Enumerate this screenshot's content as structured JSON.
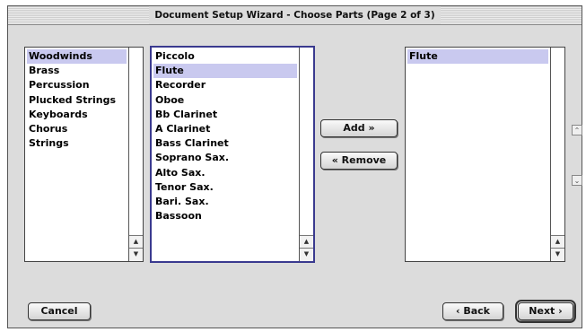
{
  "window": {
    "title": "Document Setup Wizard - Choose Parts (Page 2 of 3)"
  },
  "categories": {
    "items": [
      "Woodwinds",
      "Brass",
      "Percussion",
      "Plucked Strings",
      "Keyboards",
      "Chorus",
      "Strings"
    ],
    "selected": "Woodwinds"
  },
  "instruments": {
    "items": [
      "Piccolo",
      "Flute",
      "Recorder",
      "Oboe",
      "Bb Clarinet",
      "A Clarinet",
      "Bass Clarinet",
      "Soprano Sax.",
      "Alto Sax.",
      "Tenor Sax.",
      "Bari. Sax.",
      "Bassoon"
    ],
    "selected": "Flute"
  },
  "chosen": {
    "items": [
      "Flute"
    ],
    "selected": "Flute"
  },
  "buttons": {
    "add": "Add »",
    "remove": "« Remove",
    "cancel": "Cancel",
    "back": "‹ Back",
    "next": "Next ›"
  },
  "icons": {
    "scroll_up": "triangle-up",
    "scroll_down": "triangle-down",
    "move_up": "chevron-up",
    "move_down": "chevron-down"
  },
  "colors": {
    "selection": "#c9c9ef",
    "focus_border": "#3a3a8f",
    "dialog_bg": "#dcdcdc"
  }
}
